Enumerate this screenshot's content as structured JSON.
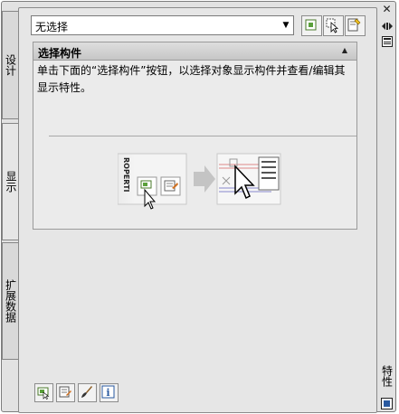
{
  "tabs": [
    {
      "label": "设计"
    },
    {
      "label": "显示"
    },
    {
      "label": "扩展数据"
    }
  ],
  "selection": {
    "value": "无选择"
  },
  "section": {
    "title": "选择构件",
    "description": "单击下面的“选择构件”按钮，以选择对象显示构件并查看/编辑其显示特性。"
  },
  "palette": {
    "title": "特性"
  },
  "illustration": {
    "logo_text": "ROPERTI"
  }
}
